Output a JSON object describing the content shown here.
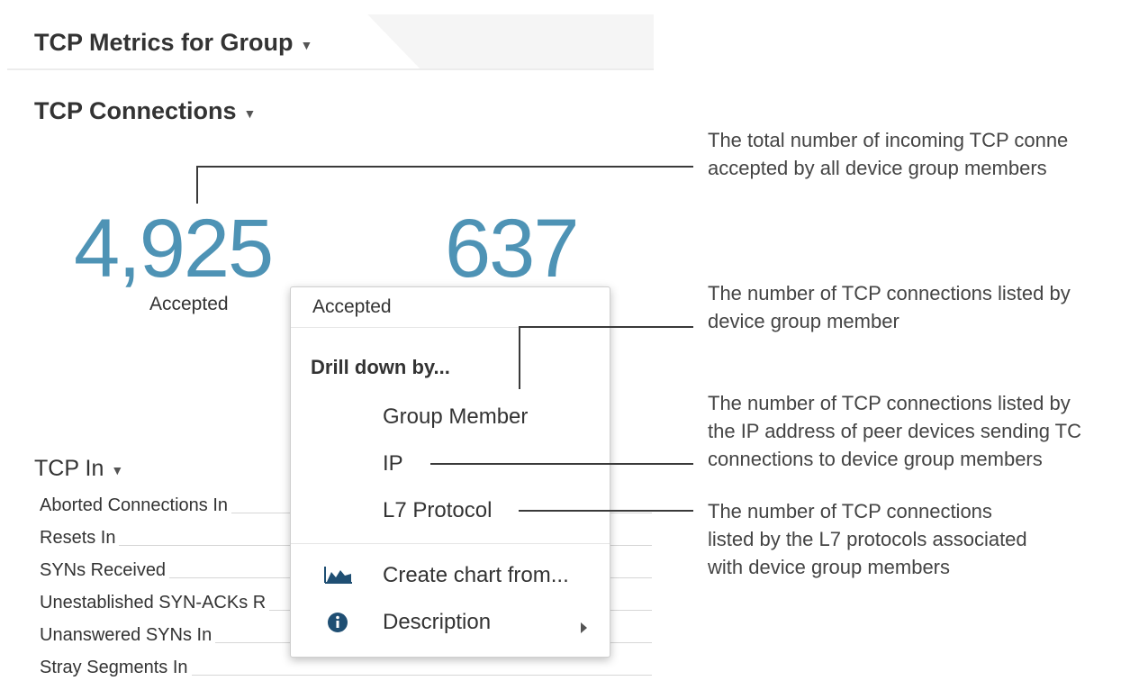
{
  "header": {
    "title": "TCP Metrics for Group"
  },
  "section": {
    "title": "TCP Connections"
  },
  "metrics": [
    {
      "value": "4,925",
      "label": "Accepted"
    },
    {
      "value": "637"
    }
  ],
  "tcp_in": {
    "title": "TCP In",
    "rows": [
      "Aborted Connections In",
      "Resets In",
      "SYNs Received",
      "Unestablished SYN-ACKs R",
      "Unanswered SYNs In",
      "Stray Segments In"
    ]
  },
  "menu": {
    "header": "Accepted",
    "drill_label": "Drill down by...",
    "items": [
      "Group Member",
      "IP",
      "L7 Protocol"
    ],
    "create_chart": "Create chart from...",
    "description": "Description"
  },
  "callouts": [
    {
      "lines": [
        "The total number of incoming TCP conne",
        "accepted by all device group members"
      ]
    },
    {
      "lines": [
        "The number of TCP connections listed by",
        "device group member"
      ]
    },
    {
      "lines": [
        "The number of TCP connections listed by",
        "the IP address of peer devices sending TC",
        "connections to device group members"
      ]
    },
    {
      "lines": [
        "The number of TCP connections",
        "listed by the L7 protocols associated",
        "with device group members"
      ]
    }
  ],
  "colors": {
    "metric": "#4e93b5",
    "line": "#3a3a3a",
    "icon": "#1f4f73"
  }
}
